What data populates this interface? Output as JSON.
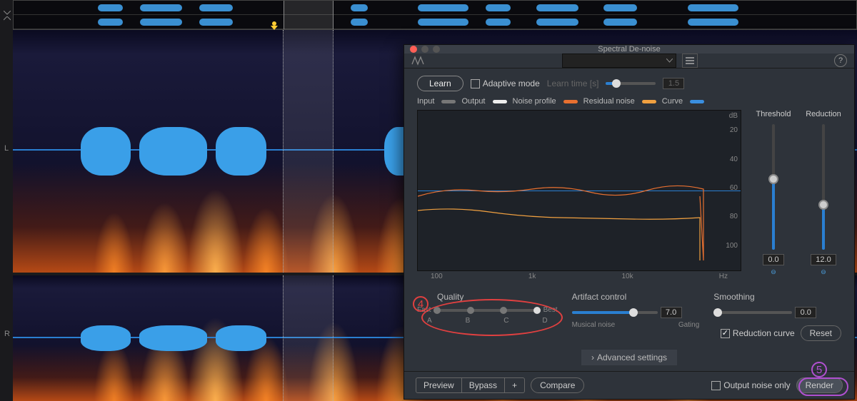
{
  "window_title": "Spectral De-noise",
  "channels": {
    "left": "L",
    "right": "R"
  },
  "db_label": "dB",
  "learn": {
    "button": "Learn",
    "adaptive_label": "Adaptive mode",
    "learn_time_label": "Learn time [s]",
    "learn_time_value": "1.5"
  },
  "legend": {
    "input": "Input",
    "output": "Output",
    "noise_profile": "Noise profile",
    "residual_noise": "Residual noise",
    "curve": "Curve"
  },
  "graph": {
    "y_unit": "dB",
    "y_ticks": [
      "20",
      "40",
      "60",
      "80",
      "100"
    ],
    "x_ticks": [
      "100",
      "1k",
      "10k"
    ],
    "x_unit": "Hz"
  },
  "threshold": {
    "label": "Threshold",
    "value": "0.0"
  },
  "reduction": {
    "label": "Reduction",
    "value": "12.0"
  },
  "quality": {
    "label": "Quality",
    "fast": "Fast",
    "best": "Best",
    "steps": [
      "A",
      "B",
      "C",
      "D"
    ]
  },
  "artifact": {
    "label": "Artifact control",
    "value": "7.0",
    "left": "Musical noise",
    "right": "Gating"
  },
  "smoothing": {
    "label": "Smoothing",
    "value": "0.0"
  },
  "reduction_curve_label": "Reduction curve",
  "reset_label": "Reset",
  "advanced_label": "Advanced settings",
  "footer": {
    "preview": "Preview",
    "bypass": "Bypass",
    "plus": "+",
    "compare": "Compare",
    "output_noise_only": "Output noise only",
    "render": "Render"
  },
  "colors": {
    "input": "#777",
    "output": "#eee",
    "noise_profile": "#e87030",
    "residual_noise": "#f0a040",
    "curve": "#3a8fe0"
  },
  "annotations": {
    "four": "4",
    "five": "5"
  }
}
